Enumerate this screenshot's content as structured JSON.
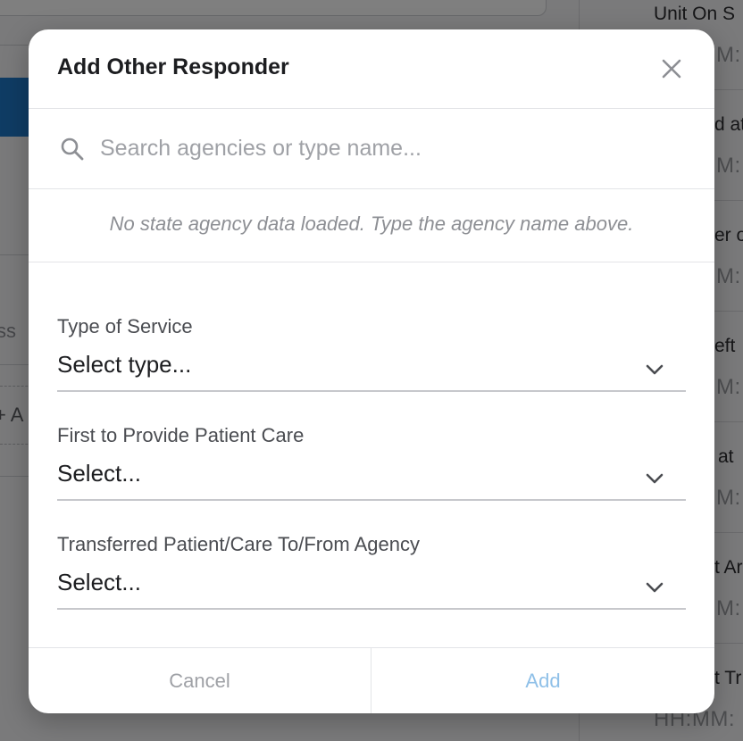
{
  "background": {
    "left_fragments": [
      "ss",
      "+  A"
    ],
    "right_column": [
      {
        "label": "Unit On S",
        "value": "M:"
      },
      {
        "label": "d at",
        "value": "M:"
      },
      {
        "label": "er o",
        "value": "M:"
      },
      {
        "label": "eft",
        "value": "M:"
      },
      {
        "label": "at",
        "value": "M:"
      },
      {
        "label": "t Ar",
        "value": "M:"
      },
      {
        "label": "t Tr",
        "value": "HH:MM:"
      }
    ]
  },
  "modal": {
    "title": "Add Other Responder",
    "close_icon": "close-icon",
    "search": {
      "icon": "search-icon",
      "placeholder": "Search agencies or type name...",
      "value": ""
    },
    "note": "No state agency data loaded. Type the agency name above.",
    "fields": [
      {
        "label": "Type of Service",
        "value": "Select type..."
      },
      {
        "label": "First to Provide Patient Care",
        "value": "Select..."
      },
      {
        "label": "Transferred Patient/Care To/From Agency",
        "value": "Select..."
      }
    ],
    "footer": {
      "cancel_label": "Cancel",
      "add_label": "Add"
    }
  },
  "colors": {
    "overlay": "#000000",
    "accent_blue": "#1f78c8",
    "add_disabled": "#8fc0e8"
  }
}
